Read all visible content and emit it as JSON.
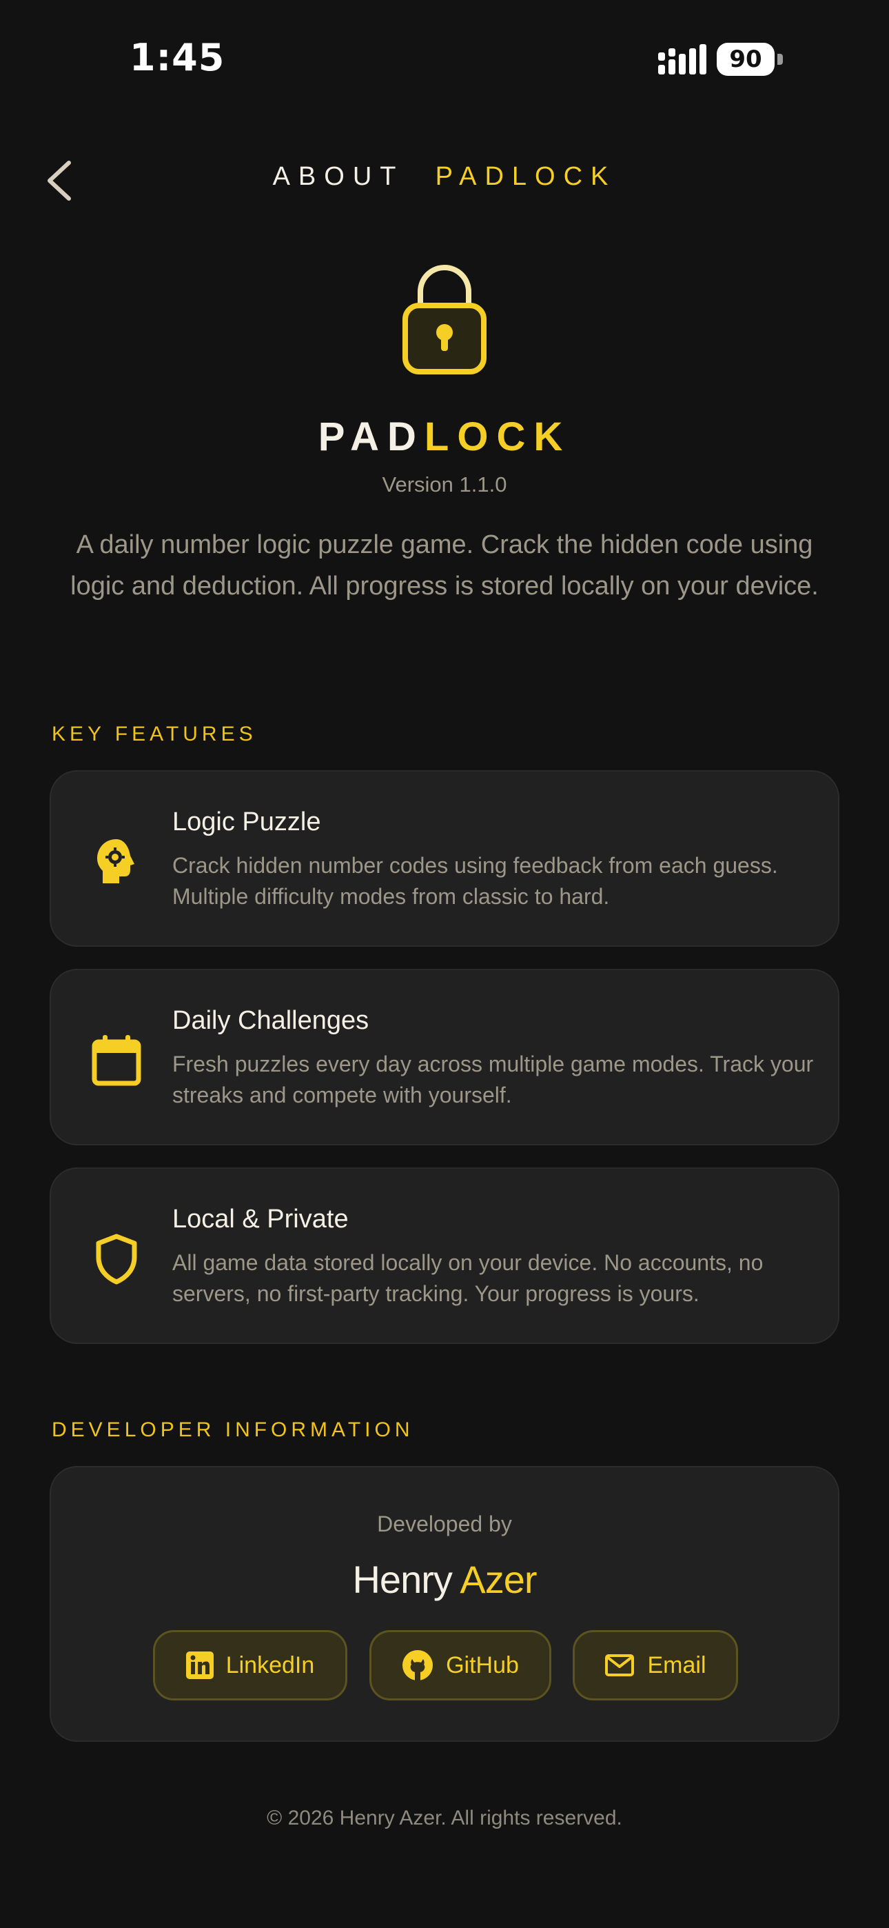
{
  "status_bar": {
    "time": "1:45",
    "battery": "90"
  },
  "header": {
    "title_word1": "ABOUT",
    "title_word2": "PADLOCK"
  },
  "app": {
    "name_part1": "PAD",
    "name_part2": "LOCK",
    "version": "Version 1.1.0",
    "description": "A daily number logic puzzle game. Crack the hidden code using logic and deduction. All progress is stored locally on your device."
  },
  "features": {
    "label": "KEY FEATURES",
    "items": [
      {
        "title": "Logic Puzzle",
        "text": "Crack hidden number codes using feedback from each guess. Multiple difficulty modes from classic to hard.",
        "icon": "brain-gear-icon"
      },
      {
        "title": "Daily Challenges",
        "text": "Fresh puzzles every day across multiple game modes. Track your streaks and compete with yourself.",
        "icon": "calendar-icon"
      },
      {
        "title": "Local & Private",
        "text": "All game data stored locally on your device. No accounts, no servers, no first-party tracking. Your progress is yours.",
        "icon": "shield-icon"
      }
    ]
  },
  "developer": {
    "label": "DEVELOPER INFORMATION",
    "developed_by": "Developed by",
    "first_name": "Henry",
    "last_name": "Azer",
    "buttons": [
      {
        "label": "LinkedIn",
        "icon": "linkedin-icon"
      },
      {
        "label": "GitHub",
        "icon": "github-icon"
      },
      {
        "label": "Email",
        "icon": "mail-icon"
      }
    ]
  },
  "footer": {
    "copyright": "© 2026 Henry Azer. All rights reserved."
  },
  "colors": {
    "background": "#121212",
    "accent": "#f5cf26",
    "card": "#212121",
    "muted_text": "#9d9789"
  }
}
